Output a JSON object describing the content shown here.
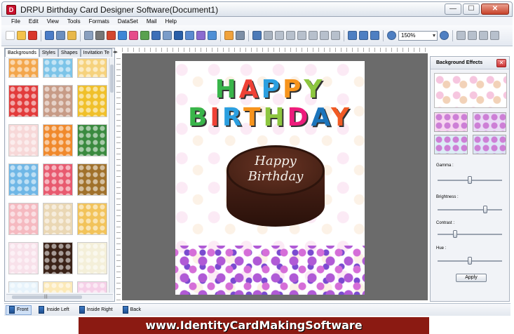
{
  "window": {
    "title": "DRPU Birthday Card Designer Software(Document1)",
    "app_icon_letter": "D"
  },
  "window_buttons": {
    "minimize": "—",
    "maximize": "☐",
    "close": "✕"
  },
  "menu": [
    "File",
    "Edit",
    "View",
    "Tools",
    "Formats",
    "DataSet",
    "Mail",
    "Help"
  ],
  "toolbar": {
    "zoom_value": "150%"
  },
  "left_panel": {
    "tabs": [
      "Backgrounds",
      "Styles",
      "Shapes",
      "Invitation Te"
    ],
    "tab_arrows": "◂▸",
    "thumbnail_colors": [
      "#f3a64b",
      "#7cc4e8",
      "#f6d27c",
      "#e23b3b",
      "#c79b86",
      "#f0c02a",
      "#f7d8d8",
      "#f0892c",
      "#3a8a3f",
      "#6fb7e6",
      "#e85a6f",
      "#a0712b",
      "#f5b9c0",
      "#ead7b4",
      "#f2c35a",
      "#f8e1ea",
      "#3b2318",
      "#f4efd9",
      "#e7f3fb",
      "#fce9b7",
      "#f6d0e8"
    ]
  },
  "card": {
    "line1": "HAPPY",
    "line2": "BIRTHDAY",
    "cake_line1": "Happy",
    "cake_line2": "Birthday",
    "colors": [
      "#39b54a",
      "#ef4136",
      "#2b9fe0",
      "#f7941d",
      "#8dc63f",
      "#ed1c7c",
      "#1c75bc",
      "#f15a24"
    ]
  },
  "background_effects": {
    "title": "Background Effects",
    "close": "✕",
    "sliders": [
      {
        "label": "Gamma :",
        "value": 0.5
      },
      {
        "label": "Brightness :",
        "value": 0.75
      },
      {
        "label": "Contrast :",
        "value": 0.25
      },
      {
        "label": "Hue :",
        "value": 0.5
      }
    ],
    "apply_label": "Apply"
  },
  "pages": [
    {
      "label": "Front",
      "active": true
    },
    {
      "label": "Inside Left",
      "active": false
    },
    {
      "label": "Inside Right",
      "active": false
    },
    {
      "label": "Back",
      "active": false
    }
  ],
  "banner": "www.IdentityCardMakingSoftware"
}
